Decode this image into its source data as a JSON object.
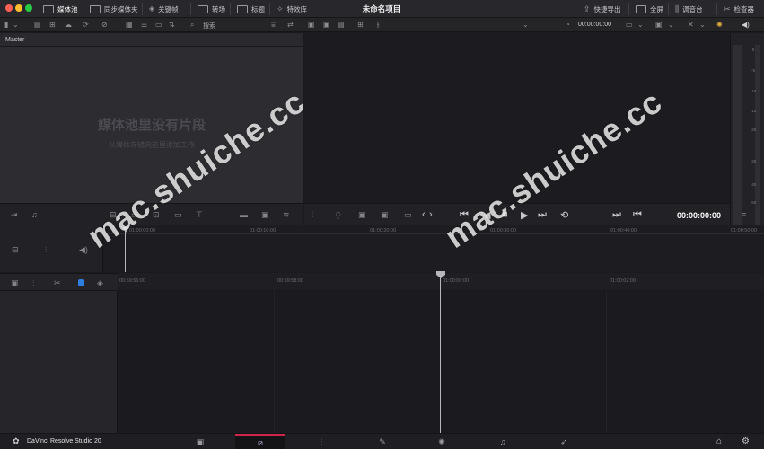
{
  "window": {
    "project_title": "未命名项目"
  },
  "topbar": {
    "left_tabs": [
      {
        "label": "媒体池",
        "icon": "media-pool-icon",
        "active": true
      },
      {
        "label": "同步媒体夹",
        "icon": "sync-bin-icon",
        "active": false
      },
      {
        "label": "关键帧",
        "icon": "keyframe-icon",
        "active": false
      },
      {
        "label": "转场",
        "icon": "transition-icon",
        "active": false
      },
      {
        "label": "标题",
        "icon": "title-icon",
        "active": false
      },
      {
        "label": "特效库",
        "icon": "effects-icon",
        "active": false
      }
    ],
    "right_tabs": [
      {
        "label": "快捷导出",
        "icon": "quick-export-icon"
      },
      {
        "label": "全屏",
        "icon": "fullscreen-icon"
      },
      {
        "label": "调音台",
        "icon": "mixer-icon"
      },
      {
        "label": "检查器",
        "icon": "inspector-icon"
      }
    ]
  },
  "toolbar": {
    "search_label": "搜索",
    "timecode": "00:00:00:00"
  },
  "media_pool": {
    "bin_name": "Master",
    "empty_title": "媒体池里没有片段",
    "empty_subtitle": "从媒体存储向这里添加工作"
  },
  "meter": {
    "ticks": [
      "0",
      "-5",
      "-10",
      "-15",
      "-20",
      "-30",
      "-40",
      "-50"
    ]
  },
  "viewer": {
    "timecode": "00:00:00:00"
  },
  "upper_timeline": {
    "ruler": [
      "01:00:00:00",
      "01:00:10:00",
      "01:00:20:00",
      "01:00:30:00",
      "01:00:40:00",
      "01:00:50:00"
    ]
  },
  "lower_timeline": {
    "ruler": [
      "00:59:56:00",
      "00:59:58:00",
      "01:00:00:00",
      "01:00:02:00"
    ]
  },
  "bottom": {
    "app_name": "DaVinci Resolve Studio 20",
    "pages": [
      "media-page",
      "cut-page",
      "edit-page",
      "fusion-page",
      "color-page",
      "fairlight-page",
      "deliver-page"
    ]
  },
  "watermark": {
    "text": "mac.shuiche.cc"
  },
  "colors": {
    "accent": "#d0254a",
    "traffic_red": "#ff5f57",
    "traffic_yellow": "#febc2e",
    "traffic_green": "#28c840"
  }
}
